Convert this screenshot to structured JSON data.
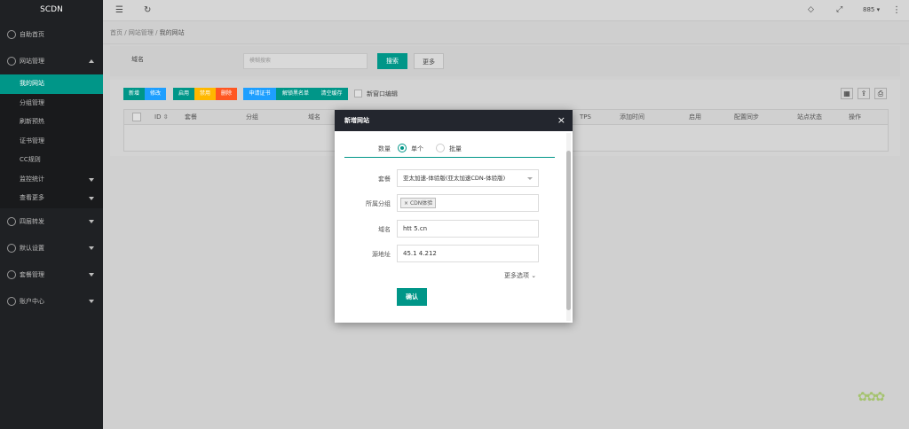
{
  "app": {
    "logo": "SCDN"
  },
  "sidebar": {
    "dashboard": "自助首页",
    "site_mgmt": "网站管理",
    "site_sub": [
      "我的网站",
      "分组管理",
      "刷新预热",
      "证书管理",
      "CC规则",
      "监控统计",
      "查看更多"
    ],
    "l4_forward": "四层转发",
    "default_settings": "默认设置",
    "package_mgmt": "套餐管理",
    "account_center": "账户中心"
  },
  "topbar": {
    "user": "885"
  },
  "breadcrumb": [
    "首页",
    "网站管理",
    "我的网站"
  ],
  "search": {
    "label": "域名",
    "placeholder": "模糊搜索",
    "search_btn": "搜索",
    "more_btn": "更多"
  },
  "toolbar": {
    "add": "新增",
    "edit": "修改",
    "enable": "启用",
    "disable": "禁用",
    "delete": "删除",
    "apply_cert": "申请证书",
    "unblock": "解锁黑名单",
    "clear_cache": "清空缓存",
    "new_window": "新窗口编辑"
  },
  "table": {
    "headers": [
      "ID",
      "套餐",
      "分组",
      "域名",
      "TPS",
      "添加时间",
      "启用",
      "配置同步",
      "站点状态",
      "操作"
    ]
  },
  "modal": {
    "title": "新增网站",
    "qty_label": "数量",
    "qty_single": "单个",
    "qty_batch": "批量",
    "package_label": "套餐",
    "package_value": "亚太加速-体验版(亚太加速CDN-体验版)",
    "group_label": "所属分组",
    "group_tag": "CDN体验",
    "domain_label": "域名",
    "domain_value": "htt 5.cn",
    "origin_label": "源地址",
    "origin_value": "45.1 4.212",
    "more_options": "更多选项",
    "confirm": "确认"
  },
  "colors": {
    "accent": "#009688",
    "blue": "#1e9fff",
    "orange": "#ffb800",
    "red": "#ff5722",
    "sidebar": "#1f2124"
  }
}
